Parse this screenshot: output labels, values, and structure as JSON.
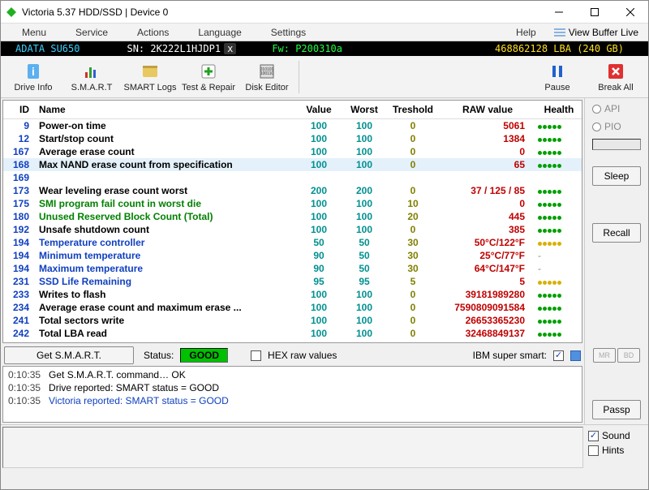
{
  "window": {
    "title": "Victoria 5.37 HDD/SSD | Device 0"
  },
  "menu": {
    "items": [
      "Menu",
      "Service",
      "Actions",
      "Language",
      "Settings"
    ],
    "help": "Help",
    "view_buffer": "View Buffer Live"
  },
  "device": {
    "model": "ADATA SU650",
    "sn": "SN: 2K222L1HJDP1",
    "fw": "Fw: P200310a",
    "lba": "468862128 LBA (240 GB)"
  },
  "toolbar": {
    "drive_info": "Drive Info",
    "smart": "S.M.A.R.T",
    "smart_logs": "SMART Logs",
    "test_repair": "Test & Repair",
    "disk_editor": "Disk Editor",
    "pause": "Pause",
    "break_all": "Break All"
  },
  "table": {
    "headers": {
      "id": "ID",
      "name": "Name",
      "value": "Value",
      "worst": "Worst",
      "threshold": "Treshold",
      "raw": "RAW value",
      "health": "Health"
    },
    "rows": [
      {
        "id": "9",
        "name": "Power-on time",
        "value": "100",
        "worst": "100",
        "threshold": "0",
        "raw": "5061",
        "health": "g",
        "ncls": "clr-black"
      },
      {
        "id": "12",
        "name": "Start/stop count",
        "value": "100",
        "worst": "100",
        "threshold": "0",
        "raw": "1384",
        "health": "g",
        "ncls": "clr-black"
      },
      {
        "id": "167",
        "name": "Average erase count",
        "value": "100",
        "worst": "100",
        "threshold": "0",
        "raw": "0",
        "health": "g",
        "ncls": "clr-black"
      },
      {
        "id": "168",
        "name": "Max NAND erase count from specification",
        "value": "100",
        "worst": "100",
        "threshold": "0",
        "raw": "65",
        "health": "g",
        "ncls": "clr-black",
        "hl": true
      },
      {
        "id": "169",
        "name": "",
        "value": "",
        "worst": "",
        "threshold": "",
        "raw": "",
        "health": "",
        "ncls": ""
      },
      {
        "id": "173",
        "name": "Wear leveling erase count worst",
        "value": "200",
        "worst": "200",
        "threshold": "0",
        "raw": "37 / 125 / 85",
        "health": "g",
        "ncls": "clr-black"
      },
      {
        "id": "175",
        "name": "SMI program fail count in worst die",
        "value": "100",
        "worst": "100",
        "threshold": "10",
        "raw": "0",
        "health": "g",
        "ncls": "clr-green"
      },
      {
        "id": "180",
        "name": "Unused Reserved Block Count (Total)",
        "value": "100",
        "worst": "100",
        "threshold": "20",
        "raw": "445",
        "health": "g",
        "ncls": "clr-green"
      },
      {
        "id": "192",
        "name": "Unsafe shutdown count",
        "value": "100",
        "worst": "100",
        "threshold": "0",
        "raw": "385",
        "health": "g",
        "ncls": "clr-black"
      },
      {
        "id": "194",
        "name": "Temperature controller",
        "value": "50",
        "worst": "50",
        "threshold": "30",
        "raw": "50°C/122°F",
        "health": "y",
        "ncls": "clr-blue"
      },
      {
        "id": "194",
        "name": "Minimum temperature",
        "value": "90",
        "worst": "50",
        "threshold": "30",
        "raw": "25°C/77°F",
        "health": "-",
        "ncls": "clr-blue"
      },
      {
        "id": "194",
        "name": "Maximum temperature",
        "value": "90",
        "worst": "50",
        "threshold": "30",
        "raw": "64°C/147°F",
        "health": "-",
        "ncls": "clr-blue"
      },
      {
        "id": "231",
        "name": "SSD Life Remaining",
        "value": "95",
        "worst": "95",
        "threshold": "5",
        "raw": "5",
        "health": "y",
        "ncls": "clr-blue"
      },
      {
        "id": "233",
        "name": "Writes to flash",
        "value": "100",
        "worst": "100",
        "threshold": "0",
        "raw": "39181989280",
        "health": "g",
        "ncls": "clr-black"
      },
      {
        "id": "234",
        "name": "Average erase count and maximum erase ...",
        "value": "100",
        "worst": "100",
        "threshold": "0",
        "raw": "7590809091584",
        "health": "g",
        "ncls": "clr-black"
      },
      {
        "id": "241",
        "name": "Total sectors write",
        "value": "100",
        "worst": "100",
        "threshold": "0",
        "raw": "26653365230",
        "health": "g",
        "ncls": "clr-black"
      },
      {
        "id": "242",
        "name": "Total LBA read",
        "value": "100",
        "worst": "100",
        "threshold": "0",
        "raw": "32468849137",
        "health": "g",
        "ncls": "clr-black"
      }
    ]
  },
  "bottom": {
    "get_smart": "Get S.M.A.R.T.",
    "status_label": "Status:",
    "status_value": "GOOD",
    "hex_label": "HEX raw values",
    "ibm_label": "IBM super smart:"
  },
  "log": [
    {
      "t": "0:10:35",
      "msg": "Get S.M.A.R.T. command… OK",
      "cls": "clr-black"
    },
    {
      "t": "0:10:35",
      "msg": "Drive reported: SMART status = GOOD",
      "cls": "clr-black"
    },
    {
      "t": "0:10:35",
      "msg": "Victoria reported: SMART status = GOOD",
      "cls": "clr-blue"
    }
  ],
  "side": {
    "api": "API",
    "pio": "PIO",
    "sleep": "Sleep",
    "recall": "Recall",
    "passp": "Passp",
    "mr": "MR",
    "bd": "BD"
  },
  "footer": {
    "sound": "Sound",
    "hints": "Hints"
  }
}
